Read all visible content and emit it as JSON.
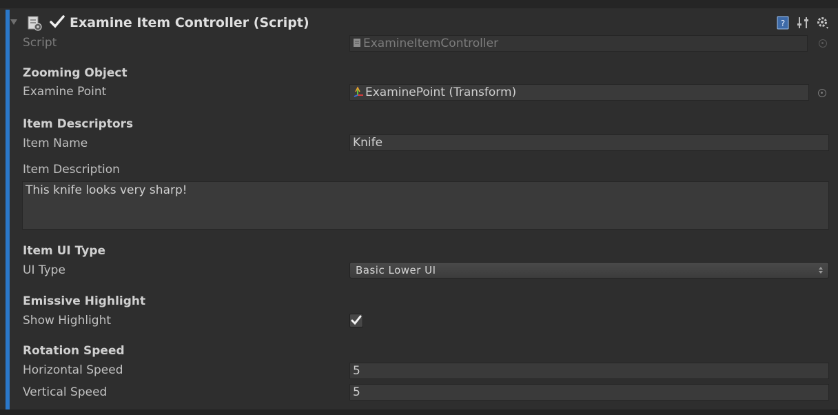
{
  "component": {
    "title": "Examine Item Controller (Script)",
    "enabled": true
  },
  "script_row": {
    "label": "Script",
    "value": "ExamineItemController"
  },
  "zooming": {
    "header": "Zooming Object",
    "examine_point_label": "Examine Point",
    "examine_point_value": "ExaminePoint (Transform)"
  },
  "descriptors": {
    "header": "Item Descriptors",
    "name_label": "Item Name",
    "name_value": "Knife",
    "description_label": "Item Description",
    "description_value": "This knife looks very sharp!"
  },
  "ui_type": {
    "header": "Item UI Type",
    "label": "UI Type",
    "selected": "Basic Lower UI"
  },
  "highlight": {
    "header": "Emissive Highlight",
    "label": "Show Highlight",
    "checked": true
  },
  "rotation": {
    "header": "Rotation Speed",
    "horizontal_label": "Horizontal Speed",
    "horizontal_value": "5",
    "vertical_label": "Vertical Speed",
    "vertical_value": "5"
  },
  "icons": {
    "foldout": "foldout-arrow-icon",
    "script": "script-component-icon",
    "help": "help-book-icon",
    "presets": "presets-sliders-icon",
    "settings": "gear-icon",
    "object_picker": "object-picker-icon"
  },
  "colors": {
    "accent": "#2a77c9",
    "background": "#2e2e2e"
  }
}
